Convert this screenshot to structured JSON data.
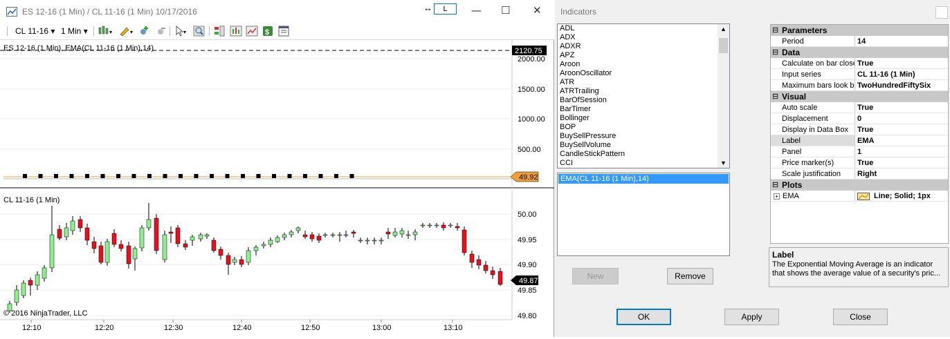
{
  "window": {
    "title": "ES 12-16 (1 Min) / CL 11-16 (1 Min)  10/17/2016",
    "l_button": "L"
  },
  "toolbar": {
    "instrument": "CL 11-16",
    "interval": "1 Min"
  },
  "chart": {
    "upper_label": "ES 12-16 (1 Min), EMA(CL 11-16 (1 Min),14)",
    "upper_ticks": [
      "2000.00",
      "1500.00",
      "1000.00",
      "500.00"
    ],
    "upper_price_badge": "2120.75",
    "ema_badge": "49.92",
    "lower_label": "CL 11-16 (1 Min)",
    "lower_ticks": [
      "50.00",
      "49.95",
      "49.90",
      "49.85",
      "49.80"
    ],
    "lower_price_badge": "49.87",
    "copyright": "© 2016 NinjaTrader, LLC",
    "time_labels": [
      "12:10",
      "12:20",
      "12:30",
      "12:40",
      "12:50",
      "13:00",
      "13:10"
    ],
    "colors": {
      "up": "#90ee90",
      "down": "#e8101f",
      "ema": "#f0a030"
    }
  },
  "dialog": {
    "title": "Indicators",
    "indicators": [
      "ADL",
      "ADX",
      "ADXR",
      "APZ",
      "Aroon",
      "AroonOscillator",
      "ATR",
      "ATRTrailing",
      "BarOfSession",
      "BarTimer",
      "Bollinger",
      "BOP",
      "BuySellPressure",
      "BuySellVolume",
      "CandleStickPattern",
      "CCI"
    ],
    "selected": "EMA(CL 11-16 (1 Min),14)",
    "new_label": "New",
    "remove_label": "Remove",
    "ok_label": "OK",
    "apply_label": "Apply",
    "close_label": "Close",
    "categories": {
      "parameters": "Parameters",
      "data": "Data",
      "visual": "Visual",
      "plots": "Plots"
    },
    "params": [
      {
        "k": "Period",
        "v": "14"
      }
    ],
    "data_props": [
      {
        "k": "Calculate on bar close",
        "v": "True"
      },
      {
        "k": "Input series",
        "v": "CL 11-16 (1 Min)"
      },
      {
        "k": "Maximum bars look back",
        "v": "TwoHundredFiftySix"
      }
    ],
    "visual_props": [
      {
        "k": "Auto scale",
        "v": "True"
      },
      {
        "k": "Displacement",
        "v": "0"
      },
      {
        "k": "Display in Data Box",
        "v": "True"
      },
      {
        "k": "Label",
        "v": "EMA"
      },
      {
        "k": "Panel",
        "v": "1"
      },
      {
        "k": "Price marker(s)",
        "v": "True"
      },
      {
        "k": "Scale justification",
        "v": "Right"
      }
    ],
    "plot": {
      "k": "EMA",
      "v": "Line; Solid; 1px"
    },
    "desc_title": "Label",
    "desc_text": "The Exponential Moving Average is an indicator that shows the average value of a security's pric..."
  }
}
